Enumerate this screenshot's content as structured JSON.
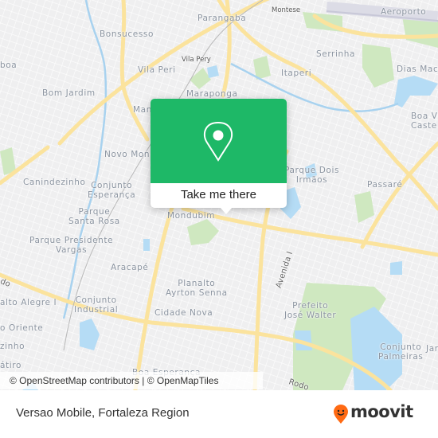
{
  "map": {
    "neighborhoods": [
      {
        "name": "Bonsucesso"
      },
      {
        "name": "Parangaba"
      },
      {
        "name": "Montese"
      },
      {
        "name": "Aeroporto"
      },
      {
        "name": "Serrinha"
      },
      {
        "name": "Vila Pery"
      },
      {
        "name": "Vila Peri"
      },
      {
        "name": "Itaperi"
      },
      {
        "name": "Dias Mace"
      },
      {
        "name": "Bom Jardim"
      },
      {
        "name": "boa"
      },
      {
        "name": "Maraponga"
      },
      {
        "name": "Man"
      },
      {
        "name": "Boa Vi\nCaste"
      },
      {
        "name": "Novo Mon"
      },
      {
        "name": "Parque Dois\nIrmãos"
      },
      {
        "name": "Passaré"
      },
      {
        "name": "Canindezinho"
      },
      {
        "name": "Conjunto\nEsperança"
      },
      {
        "name": "Mondubim"
      },
      {
        "name": "Parque\nSanta Rosa"
      },
      {
        "name": "Parque Presidente\nVargas"
      },
      {
        "name": "Aracapé"
      },
      {
        "name": "Avenida I"
      },
      {
        "name": "Planalto\nAyrton Senna"
      },
      {
        "name": "Prefeito\nJosé Walter"
      },
      {
        "name": "alto Alegre I"
      },
      {
        "name": "Conjunto\nIndustrial"
      },
      {
        "name": "Cidade Nova"
      },
      {
        "name": "o Oriente"
      },
      {
        "name": "zinho"
      },
      {
        "name": "átiro"
      },
      {
        "name": "Conjunto\nPalmeiras"
      },
      {
        "name": "Jar"
      },
      {
        "name": "Boa Esperança"
      },
      {
        "name": "Rodo"
      },
      {
        "name": "do"
      }
    ],
    "attribution": "© OpenStreetMap contributors | © OpenMapTiles"
  },
  "popup": {
    "icon": "map-pin-icon",
    "button_label": "Take me there",
    "color": "#1eb867"
  },
  "footer": {
    "title": "Versao Mobile, Fortaleza Region",
    "brand": "moovit",
    "brand_color": "#ff6a13"
  }
}
